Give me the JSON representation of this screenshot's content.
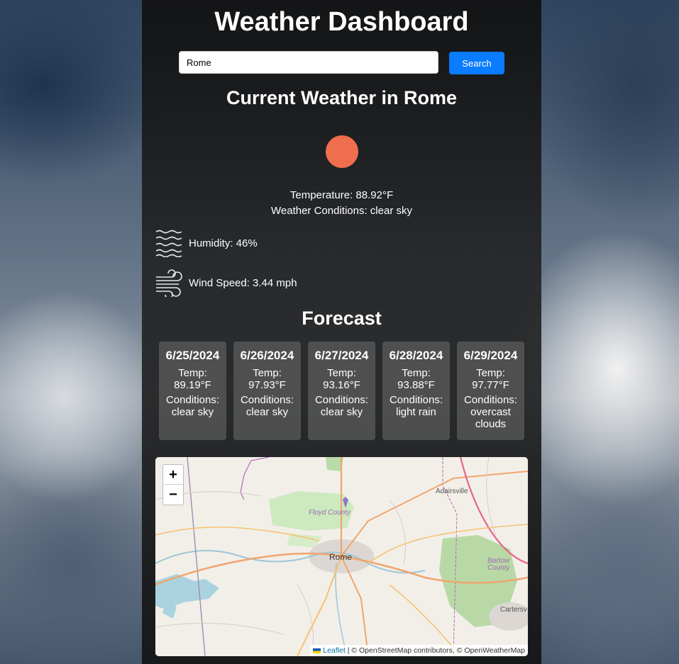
{
  "header": {
    "title": "Weather Dashboard"
  },
  "search": {
    "value": "Rome",
    "button_label": "Search"
  },
  "current": {
    "title": "Current Weather in Rome",
    "icon": "sun-icon",
    "icon_color": "#ee6e4d",
    "temperature": "Temperature: 88.92°F",
    "conditions": "Weather Conditions: clear sky",
    "humidity": "Humidity: 46%",
    "wind": "Wind Speed: 3.44 mph"
  },
  "forecast": {
    "title": "Forecast",
    "days": [
      {
        "date": "6/25/2024",
        "temp_label": "Temp:",
        "temp": "89.19°F",
        "cond_label": "Conditions:",
        "cond": [
          "clear sky"
        ]
      },
      {
        "date": "6/26/2024",
        "temp_label": "Temp:",
        "temp": "97.93°F",
        "cond_label": "Conditions:",
        "cond": [
          "clear sky"
        ]
      },
      {
        "date": "6/27/2024",
        "temp_label": "Temp:",
        "temp": "93.16°F",
        "cond_label": "Conditions:",
        "cond": [
          "clear sky"
        ]
      },
      {
        "date": "6/28/2024",
        "temp_label": "Temp:",
        "temp": "93.88°F",
        "cond_label": "Conditions:",
        "cond": [
          "light rain"
        ]
      },
      {
        "date": "6/29/2024",
        "temp_label": "Temp:",
        "temp": "97.77°F",
        "cond_label": "Conditions:",
        "cond": [
          "overcast",
          "clouds"
        ]
      }
    ]
  },
  "map": {
    "zoom_in": "+",
    "zoom_out": "−",
    "labels": {
      "city": "Rome",
      "county": [
        "Floyd",
        "County"
      ],
      "town_ne": "Adairsville",
      "county_e": [
        "Bartow",
        "County"
      ],
      "town_se": "Cartersv"
    },
    "attribution": {
      "leaflet": "Leaflet",
      "rest": " | © OpenStreetMap contributors, © OpenWeatherMap"
    }
  },
  "colors": {
    "accent": "#0a7cff",
    "sun": "#ee6e4d"
  }
}
